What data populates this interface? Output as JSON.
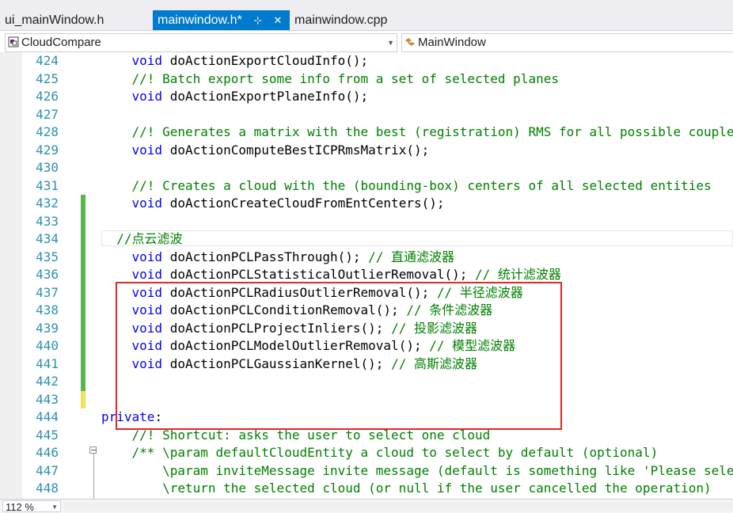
{
  "tabs": [
    {
      "label": "ui_mainWindow.h",
      "active": false
    },
    {
      "label": "mainwindow.h*",
      "active": true
    },
    {
      "label": "mainwindow.cpp",
      "active": false
    }
  ],
  "tab_icons": {
    "pin": "pin-icon",
    "close": "close-icon"
  },
  "nav": {
    "project": "CloudCompare",
    "scope": "MainWindow"
  },
  "code_lines": [
    {
      "n": "424",
      "kw": "void ",
      "code": "doActionExportCloudInfo();",
      "cm": ""
    },
    {
      "n": "425",
      "kw": "",
      "code": "",
      "cm": "//! Batch export some info from a set of selected planes"
    },
    {
      "n": "426",
      "kw": "void ",
      "code": "doActionExportPlaneInfo();",
      "cm": ""
    },
    {
      "n": "427",
      "kw": "",
      "code": "",
      "cm": ""
    },
    {
      "n": "428",
      "kw": "",
      "code": "",
      "cm": "//! Generates a matrix with the best (registration) RMS for all possible couple amon"
    },
    {
      "n": "429",
      "kw": "void ",
      "code": "doActionComputeBestICPRmsMatrix();",
      "cm": ""
    },
    {
      "n": "430",
      "kw": "",
      "code": "",
      "cm": ""
    },
    {
      "n": "431",
      "kw": "",
      "code": "",
      "cm": "//! Creates a cloud with the (bounding-box) centers of all selected entities"
    },
    {
      "n": "432",
      "kw": "void ",
      "code": "doActionCreateCloudFromEntCenters();",
      "cm": ""
    },
    {
      "n": "433",
      "kw": "",
      "code": "",
      "cm": ""
    },
    {
      "n": "434",
      "kw": "",
      "code": "",
      "cm": "//点云滤波"
    },
    {
      "n": "435",
      "kw": "void ",
      "code": "doActionPCLPassThrough(); ",
      "cm": "// 直通滤波器"
    },
    {
      "n": "436",
      "kw": "void ",
      "code": "doActionPCLStatisticalOutlierRemoval(); ",
      "cm": "// 统计滤波器"
    },
    {
      "n": "437",
      "kw": "void ",
      "code": "doActionPCLRadiusOutlierRemoval(); ",
      "cm": "// 半径滤波器"
    },
    {
      "n": "438",
      "kw": "void ",
      "code": "doActionPCLConditionRemoval(); ",
      "cm": "// 条件滤波器"
    },
    {
      "n": "439",
      "kw": "void ",
      "code": "doActionPCLProjectInliers(); ",
      "cm": "// 投影滤波器"
    },
    {
      "n": "440",
      "kw": "void ",
      "code": "doActionPCLModelOutlierRemoval(); ",
      "cm": "// 模型滤波器"
    },
    {
      "n": "441",
      "kw": "void ",
      "code": "doActionPCLGaussianKernel(); ",
      "cm": "// 高斯滤波器"
    },
    {
      "n": "442",
      "kw": "",
      "code": "",
      "cm": ""
    },
    {
      "n": "443",
      "kw": "",
      "code": "",
      "cm": ""
    },
    {
      "n": "444",
      "kw": "private",
      "code": ":",
      "cm": ""
    },
    {
      "n": "445",
      "kw": "",
      "code": "",
      "cm": "//! Shortcut: asks the user to select one cloud"
    },
    {
      "n": "446",
      "kw": "",
      "code": "",
      "cm": "/** \\param defaultCloudEntity a cloud to select by default (optional)"
    },
    {
      "n": "447",
      "kw": "",
      "code": "",
      "cm": "\\param inviteMessage invite message (default is something like 'Please select an"
    },
    {
      "n": "448",
      "kw": "",
      "code": "",
      "cm": "\\return the selected cloud (or null if the user cancelled the operation)"
    }
  ],
  "status": {
    "zoom": "112 %"
  }
}
